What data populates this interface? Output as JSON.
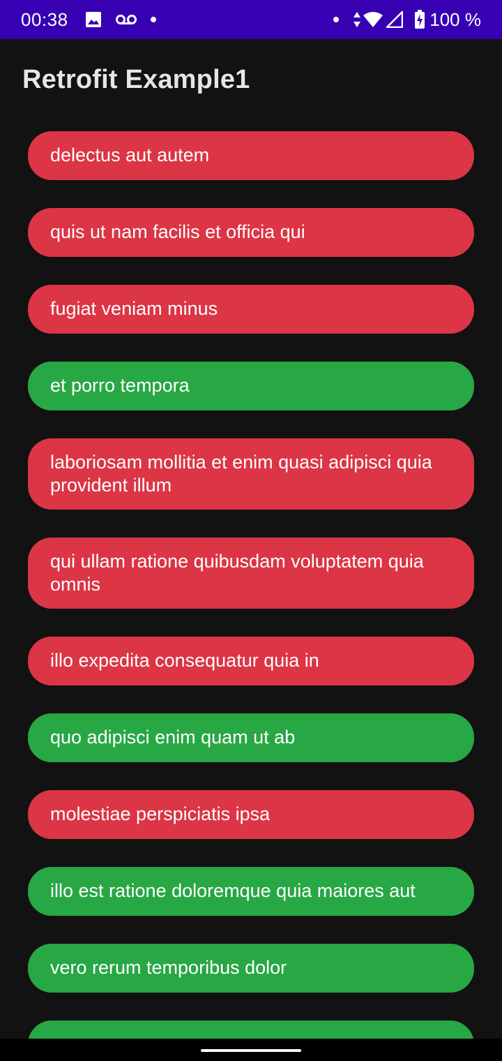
{
  "status_bar": {
    "time": "00:38",
    "battery": "100 %",
    "icons": [
      "image-icon",
      "voicemail-icon",
      "notification-dot-icon",
      "notification-dot-icon",
      "data-arrows-icon",
      "wifi-icon",
      "cell-signal-icon",
      "battery-charging-icon"
    ]
  },
  "toolbar": {
    "title": "Retrofit Example1"
  },
  "colors": {
    "status_bar": "#3700b3",
    "background": "#121212",
    "incomplete": "#dc3545",
    "completed": "#28a745"
  },
  "todos": [
    {
      "title": "delectus aut autem",
      "status": "red"
    },
    {
      "title": "quis ut nam facilis et officia qui",
      "status": "red"
    },
    {
      "title": "fugiat veniam minus",
      "status": "red"
    },
    {
      "title": "et porro tempora",
      "status": "green"
    },
    {
      "title": "laboriosam mollitia et enim quasi adipisci quia provident illum",
      "status": "red"
    },
    {
      "title": "qui ullam ratione quibusdam voluptatem quia omnis",
      "status": "red"
    },
    {
      "title": "illo expedita consequatur quia in",
      "status": "red"
    },
    {
      "title": "quo adipisci enim quam ut ab",
      "status": "green"
    },
    {
      "title": "molestiae perspiciatis ipsa",
      "status": "red"
    },
    {
      "title": "illo est ratione doloremque quia maiores aut",
      "status": "green"
    },
    {
      "title": "vero rerum temporibus dolor",
      "status": "green"
    },
    {
      "title": "",
      "status": "green"
    }
  ]
}
